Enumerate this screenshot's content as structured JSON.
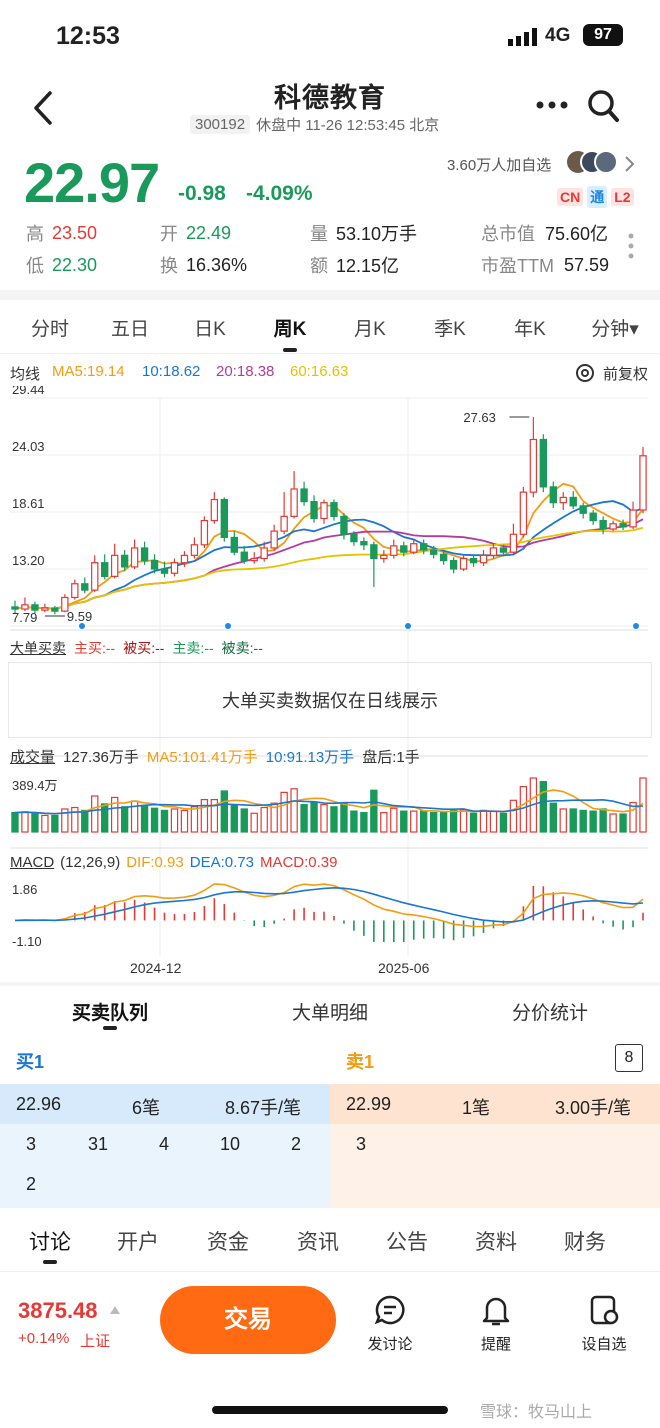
{
  "status_bar": {
    "time": "12:53",
    "network": "4G",
    "battery": "97"
  },
  "nav": {
    "title": "科德教育",
    "code": "300192",
    "status_text": "休盘中 11-26 12:53:45 北京"
  },
  "quote": {
    "price": "22.97",
    "change": "-0.98",
    "change_pct": "-4.09%",
    "watchers": "3.60万人加自选",
    "badges": [
      "CN",
      "通",
      "L2"
    ],
    "stats": [
      {
        "label": "高",
        "value": "23.50",
        "color": "red"
      },
      {
        "label": "开",
        "value": "22.49",
        "color": "green"
      },
      {
        "label": "量",
        "value": "53.10万手",
        "color": "plain"
      },
      {
        "label": "总市值",
        "value": "75.60亿",
        "color": "plain"
      },
      {
        "label": "低",
        "value": "22.30",
        "color": "green"
      },
      {
        "label": "换",
        "value": "16.36%",
        "color": "plain"
      },
      {
        "label": "额",
        "value": "12.15亿",
        "color": "plain"
      },
      {
        "label": "市盈TTM",
        "value": "57.59",
        "color": "plain"
      }
    ]
  },
  "period_tabs": [
    "分时",
    "五日",
    "日K",
    "周K",
    "月K",
    "季K",
    "年K",
    "分钟▾"
  ],
  "active_period": "周K",
  "ma": {
    "label": "均线",
    "ma5": "MA5:19.14",
    "ma10": "10:18.62",
    "ma20": "20:18.38",
    "ma60": "60:16.63",
    "fq": "前复权"
  },
  "price_axis": [
    "29.44",
    "24.03",
    "18.61",
    "13.20",
    "7.79"
  ],
  "annotations": {
    "high": "27.63",
    "low": "9.59"
  },
  "bigorder": {
    "label": "大单买卖",
    "zhumai": "主买:--",
    "beimai": "被买:--",
    "zhumai2": "主卖:--",
    "beimai2": "被卖:--",
    "notice": "大单买卖数据仅在日线展示"
  },
  "volume": {
    "label": "成交量",
    "value": "127.36万手",
    "ma5": "MA5:101.41万手",
    "ma10": "10:91.13万手",
    "after": "盘后:1手",
    "max_label": "389.4万"
  },
  "macd": {
    "label": "MACD",
    "params": "(12,26,9)",
    "dif": "DIF:0.93",
    "dea": "DEA:0.73",
    "macd": "MACD:0.39",
    "top": "1.86",
    "bottom": "-1.10"
  },
  "x_axis": [
    "2024-12",
    "2025-06"
  ],
  "order_tabs": [
    "买卖队列",
    "大单明细",
    "分价统计"
  ],
  "book": {
    "buy_label": "买1",
    "sell_label": "卖1",
    "level": "8",
    "buy_price": "22.96",
    "buy_count": "6笔",
    "buy_avg": "8.67手/笔",
    "sell_price": "22.99",
    "sell_count": "1笔",
    "sell_avg": "3.00手/笔",
    "buy_queue": [
      "3",
      "31",
      "4",
      "10",
      "2",
      "2"
    ],
    "sell_queue": [
      "3"
    ]
  },
  "bottom_tabs": [
    "讨论",
    "开户",
    "资金",
    "资讯",
    "公告",
    "资料",
    "财务"
  ],
  "footer": {
    "index_value": "3875.48",
    "index_change": "+0.14%",
    "index_name": "上证",
    "trade": "交易",
    "discuss": "发讨论",
    "alert": "提醒",
    "watch": "设自选",
    "watermark": "雪球：牧马山上"
  },
  "colors": {
    "up": "#e53935",
    "down": "#1a9a5a",
    "ma5": "#f39c12",
    "ma10": "#1976d2",
    "ma20": "#b23aa5",
    "ma60": "#e6c200",
    "trade": "#ff6a13"
  },
  "chart_data": {
    "type": "candlestick",
    "price_range": [
      7.79,
      29.44
    ],
    "candles": [
      [
        9.6,
        9.4,
        10.2,
        9.0
      ],
      [
        9.4,
        9.8,
        10.5,
        9.2
      ],
      [
        9.8,
        9.3,
        10.1,
        9.0
      ],
      [
        9.3,
        9.5,
        9.9,
        9.1
      ],
      [
        9.5,
        9.2,
        9.7,
        8.9
      ],
      [
        9.2,
        10.5,
        10.8,
        9.1
      ],
      [
        10.5,
        11.8,
        12.2,
        10.3
      ],
      [
        11.8,
        11.2,
        12.4,
        10.9
      ],
      [
        11.2,
        13.8,
        14.5,
        11.0
      ],
      [
        13.8,
        12.5,
        14.6,
        12.2
      ],
      [
        12.5,
        14.5,
        15.6,
        12.3
      ],
      [
        14.5,
        13.4,
        15.0,
        13.0
      ],
      [
        13.4,
        15.2,
        16.0,
        13.2
      ],
      [
        15.2,
        14.0,
        15.8,
        13.6
      ],
      [
        14.0,
        13.2,
        14.6,
        12.8
      ],
      [
        13.2,
        12.8,
        13.9,
        12.4
      ],
      [
        12.8,
        13.8,
        14.2,
        12.5
      ],
      [
        13.8,
        14.5,
        14.9,
        13.4
      ],
      [
        14.5,
        15.5,
        16.2,
        14.2
      ],
      [
        15.5,
        17.8,
        18.2,
        15.2
      ],
      [
        17.8,
        19.8,
        20.5,
        17.5
      ],
      [
        19.8,
        16.2,
        20.0,
        15.8
      ],
      [
        16.2,
        14.8,
        16.8,
        14.5
      ],
      [
        14.8,
        14.0,
        15.4,
        13.7
      ],
      [
        14.0,
        14.2,
        14.8,
        13.7
      ],
      [
        14.2,
        15.2,
        15.8,
        13.9
      ],
      [
        15.2,
        16.8,
        17.4,
        14.9
      ],
      [
        16.8,
        18.2,
        20.5,
        16.5
      ],
      [
        18.2,
        20.8,
        22.5,
        18.0
      ],
      [
        20.8,
        19.6,
        21.5,
        19.2
      ],
      [
        19.6,
        18.0,
        20.2,
        17.6
      ],
      [
        18.0,
        19.5,
        19.8,
        17.5
      ],
      [
        19.5,
        18.2,
        19.8,
        17.8
      ],
      [
        18.2,
        16.5,
        18.5,
        16.0
      ],
      [
        16.5,
        15.8,
        16.8,
        15.4
      ],
      [
        15.8,
        15.5,
        16.2,
        15.0
      ],
      [
        15.5,
        14.2,
        15.8,
        11.5
      ],
      [
        14.2,
        14.5,
        15.0,
        13.8
      ],
      [
        14.5,
        15.4,
        16.0,
        14.2
      ],
      [
        15.4,
        14.8,
        15.8,
        14.4
      ],
      [
        14.8,
        15.6,
        16.0,
        14.6
      ],
      [
        15.6,
        15.0,
        16.0,
        14.6
      ],
      [
        15.0,
        14.6,
        15.4,
        14.2
      ],
      [
        14.6,
        14.0,
        14.9,
        13.6
      ],
      [
        14.0,
        13.2,
        14.3,
        12.8
      ],
      [
        13.2,
        14.2,
        14.6,
        13.0
      ],
      [
        14.2,
        13.8,
        14.5,
        13.4
      ],
      [
        13.8,
        14.5,
        15.0,
        13.5
      ],
      [
        14.5,
        15.2,
        15.6,
        14.2
      ],
      [
        15.2,
        14.8,
        15.5,
        14.4
      ],
      [
        14.8,
        16.5,
        17.5,
        14.6
      ],
      [
        16.5,
        20.5,
        21.0,
        16.2
      ],
      [
        20.5,
        25.5,
        27.63,
        20.0
      ],
      [
        25.5,
        21.0,
        26.0,
        20.5
      ],
      [
        21.0,
        19.5,
        21.5,
        19.0
      ],
      [
        19.5,
        20.0,
        20.5,
        18.8
      ],
      [
        20.0,
        19.2,
        20.6,
        18.9
      ],
      [
        19.2,
        18.5,
        19.5,
        18.0
      ],
      [
        18.5,
        17.8,
        18.8,
        17.4
      ],
      [
        17.8,
        17.0,
        18.2,
        16.5
      ],
      [
        17.0,
        17.5,
        17.8,
        16.8
      ],
      [
        17.5,
        17.2,
        17.9,
        16.9
      ],
      [
        17.2,
        18.8,
        19.6,
        17.0
      ],
      [
        18.8,
        23.95,
        24.8,
        18.5
      ]
    ]
  }
}
